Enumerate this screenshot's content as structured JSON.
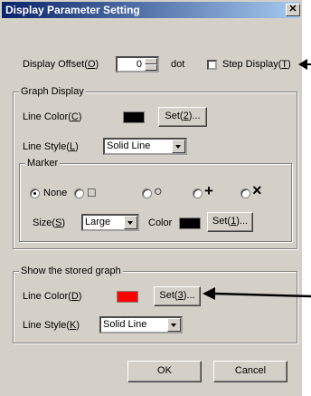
{
  "window": {
    "title": "Display Parameter Setting"
  },
  "display_offset": {
    "label": "Display Offset(",
    "key": "O",
    "label_end": ")",
    "value": "0",
    "unit": "dot"
  },
  "step_display": {
    "label": "Step Display(",
    "key": "T",
    "label_end": ")",
    "checked": false
  },
  "graph_display": {
    "legend": "Graph Display",
    "line_color": {
      "label": "Line Color(",
      "key": "C",
      "label_end": ")",
      "color": "#000000"
    },
    "set2": {
      "label": "Set(",
      "key": "2",
      "label_end": ")..."
    },
    "line_style": {
      "label": "Line Style(",
      "key": "L",
      "label_end": ")",
      "value": "Solid Line"
    },
    "marker": {
      "legend": "Marker",
      "none_label": "None",
      "symbols": [
        "□",
        "○",
        "+",
        "×"
      ],
      "selected": "None",
      "size": {
        "label": "Size(",
        "key": "S",
        "label_end": ")",
        "value": "Large"
      },
      "color": {
        "label": "Color",
        "value": "#000000"
      },
      "set1": {
        "label": "Set(",
        "key": "1",
        "label_end": ")..."
      }
    }
  },
  "stored_graph": {
    "legend": "Show the stored graph",
    "line_color": {
      "label": "Line Color(",
      "key": "D",
      "label_end": ")",
      "color": "#ff0000"
    },
    "set3": {
      "label": "Set(",
      "key": "3",
      "label_end": ")..."
    },
    "line_style": {
      "label": "Line Style(",
      "key": "K",
      "label_end": ")",
      "value": "Solid Line"
    }
  },
  "buttons": {
    "ok": "OK",
    "cancel": "Cancel"
  }
}
